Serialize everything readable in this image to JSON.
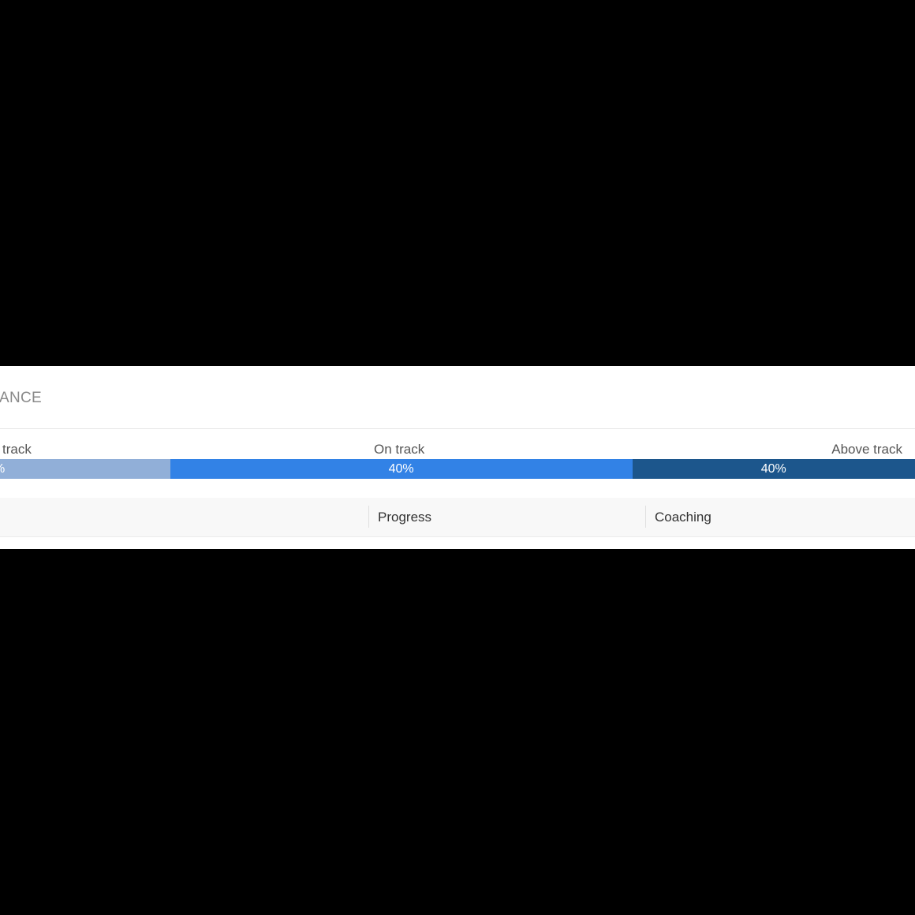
{
  "section": {
    "title": "ANCE"
  },
  "distribution": {
    "segments": [
      {
        "label": "track",
        "value_text": "%",
        "share": 0.186,
        "color": "#91afd8"
      },
      {
        "label": "On track",
        "value_text": "40%",
        "share": 0.505,
        "color": "#3282e6"
      },
      {
        "label": "Above track",
        "value_text": "40%",
        "share": 0.309,
        "color": "#1c568c"
      }
    ]
  },
  "table": {
    "columns": [
      "Progress",
      "Coaching"
    ]
  },
  "colors": {
    "background": "#000000",
    "panel": "#ffffff",
    "header_bg": "#f8f8f8"
  }
}
